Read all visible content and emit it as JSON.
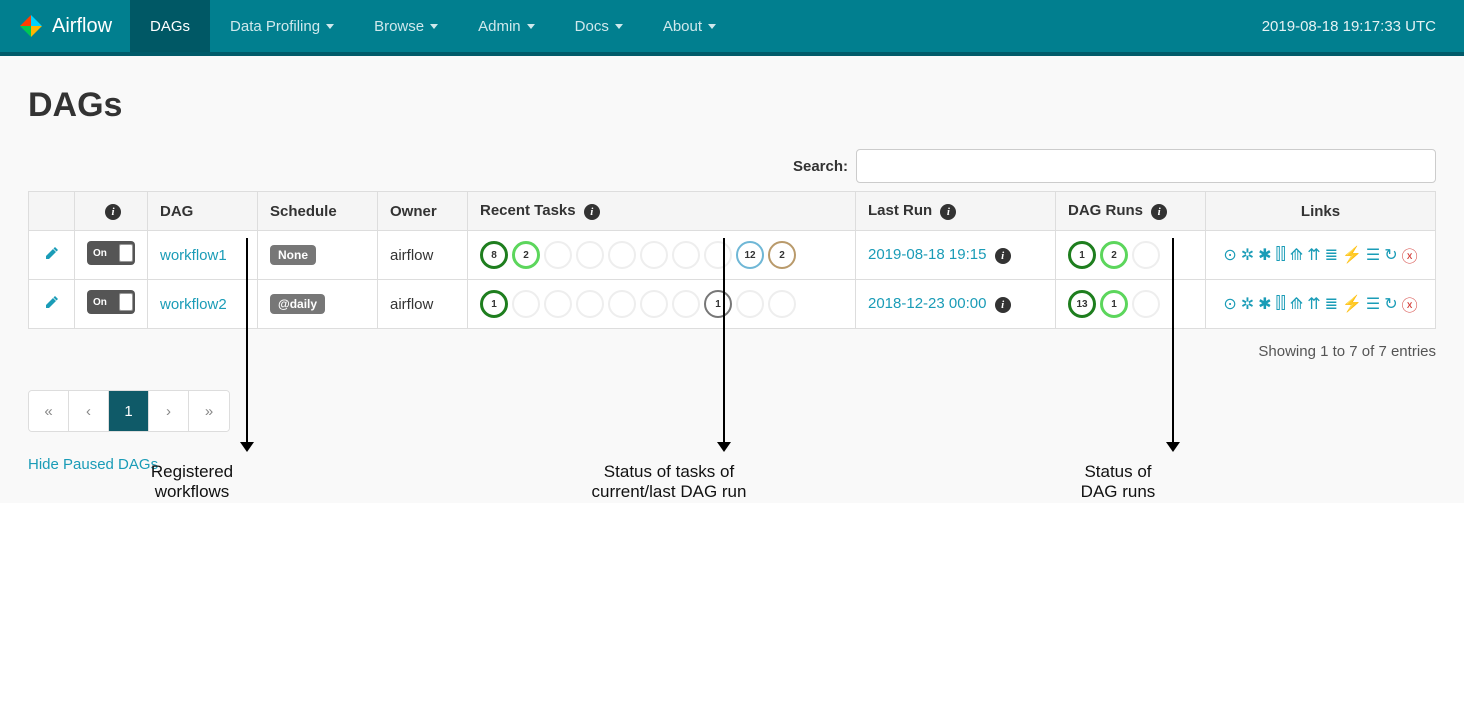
{
  "nav": {
    "brand": "Airflow",
    "items": [
      {
        "label": "DAGs",
        "dropdown": false,
        "active": true
      },
      {
        "label": "Data Profiling",
        "dropdown": true
      },
      {
        "label": "Browse",
        "dropdown": true
      },
      {
        "label": "Admin",
        "dropdown": true
      },
      {
        "label": "Docs",
        "dropdown": true
      },
      {
        "label": "About",
        "dropdown": true
      }
    ],
    "clock": "2019-08-18 19:17:33 UTC"
  },
  "page": {
    "title": "DAGs",
    "search_label": "Search:",
    "search_value": ""
  },
  "columns": {
    "info": "",
    "dag": "DAG",
    "schedule": "Schedule",
    "owner": "Owner",
    "recent_tasks": "Recent Tasks",
    "last_run": "Last Run",
    "dag_runs": "DAG Runs",
    "links": "Links"
  },
  "rows": [
    {
      "toggle": "On",
      "dag": "workflow1",
      "schedule": "None",
      "owner": "airflow",
      "recent_tasks": [
        {
          "n": "8",
          "cls": "c-darkgreen"
        },
        {
          "n": "2",
          "cls": "c-lightgreen"
        },
        {
          "n": "",
          "cls": "c-empty"
        },
        {
          "n": "",
          "cls": "c-empty"
        },
        {
          "n": "",
          "cls": "c-empty"
        },
        {
          "n": "",
          "cls": "c-empty"
        },
        {
          "n": "",
          "cls": "c-empty"
        },
        {
          "n": "",
          "cls": "c-empty"
        },
        {
          "n": "12",
          "cls": "c-blue"
        },
        {
          "n": "2",
          "cls": "c-tan"
        }
      ],
      "last_run": "2019-08-18 19:15",
      "dag_runs": [
        {
          "n": "1",
          "cls": "c-darkgreen"
        },
        {
          "n": "2",
          "cls": "c-lightgreen"
        },
        {
          "n": "",
          "cls": "c-empty"
        }
      ]
    },
    {
      "toggle": "On",
      "dag": "workflow2",
      "schedule": "@daily",
      "owner": "airflow",
      "recent_tasks": [
        {
          "n": "1",
          "cls": "c-darkgreen"
        },
        {
          "n": "",
          "cls": "c-empty"
        },
        {
          "n": "",
          "cls": "c-empty"
        },
        {
          "n": "",
          "cls": "c-empty"
        },
        {
          "n": "",
          "cls": "c-empty"
        },
        {
          "n": "",
          "cls": "c-empty"
        },
        {
          "n": "",
          "cls": "c-empty"
        },
        {
          "n": "1",
          "cls": "c-grey"
        },
        {
          "n": "",
          "cls": "c-empty"
        },
        {
          "n": "",
          "cls": "c-empty"
        }
      ],
      "last_run": "2018-12-23 00:00",
      "dag_runs": [
        {
          "n": "13",
          "cls": "c-darkgreen"
        },
        {
          "n": "1",
          "cls": "c-lightgreen"
        },
        {
          "n": "",
          "cls": "c-empty"
        }
      ]
    }
  ],
  "footer": {
    "showing": "Showing 1 to 7 of 7 entries",
    "page_current": "1",
    "hide_paused": "Hide Paused DAGs"
  },
  "annotations": {
    "a1": "Registered\nworkflows",
    "a2": "Status of tasks of\ncurrent/last DAG run",
    "a3": "Status of\nDAG runs"
  }
}
